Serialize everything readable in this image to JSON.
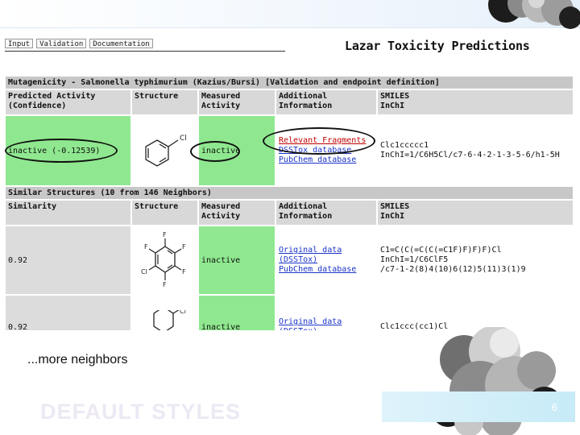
{
  "nav": {
    "tabs": [
      "Input",
      "Validation",
      "Documentation"
    ]
  },
  "title": "Lazar Toxicity Predictions",
  "endpoint_bar": "Mutagenicity - Salmonella typhimurium (Kazius/Bursi) [Validation and endpoint definition]",
  "prediction_headers": {
    "predicted_1": "Predicted Activity",
    "predicted_2": "(Confidence)",
    "structure": "Structure",
    "measured_1": "Measured",
    "measured_2": "Activity",
    "additional_1": "Additional",
    "additional_2": "Information",
    "smiles_1": "SMILES",
    "smiles_2": "InChI"
  },
  "prediction": {
    "activity": "inactive (-0.12539)",
    "measured": "inactive",
    "links": [
      "Relevant Fragments",
      "DSSTox database",
      "PubChem database"
    ],
    "smiles": "Clc1ccccc1",
    "inchi": "InChI=1/C6H5Cl/c7-6-4-2-1-3-5-6/h1-5H"
  },
  "similar_bar": "Similar Structures (10 from 146 Neighbors)",
  "similar_headers": {
    "similarity": "Similarity",
    "structure": "Structure",
    "measured_1": "Measured",
    "measured_2": "Activity",
    "additional_1": "Additional",
    "additional_2": "Information",
    "smiles_1": "SMILES",
    "smiles_2": "InChI"
  },
  "neighbors": [
    {
      "similarity": "0.92",
      "measured": "inactive",
      "links": [
        "Original data (DSSTox)",
        "PubChem database"
      ],
      "smiles": "C1=C(C(=C(C(=C1F)F)F)F)Cl",
      "inchi_1": "InChI=1/C6ClF5",
      "inchi_2": "/c7-1-2(8)4(10)6(12)5(11)3(1)9"
    },
    {
      "similarity": "0.92",
      "measured": "inactive",
      "links": [
        "Original data (DSSTox)"
      ],
      "smiles": "Clc1ccc(cc1)Cl"
    }
  ],
  "more_neighbors": "...more neighbors",
  "footer_ghost": "DEFAULT STYLES",
  "page_number": "6",
  "colors": {
    "inactive_green": "#8fe88f",
    "header_grey": "#c7c7c7",
    "link_blue": "#1a33c8",
    "fragment_red": "#c00000",
    "page_box": "#c7ebf7"
  }
}
